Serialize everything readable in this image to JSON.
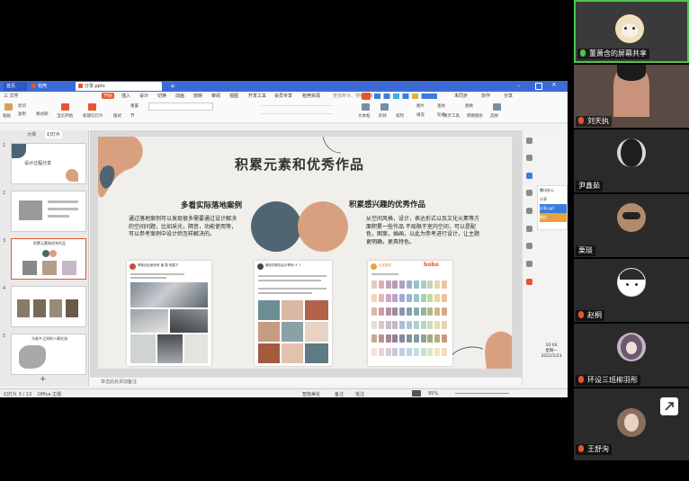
{
  "window": {
    "tabs": [
      {
        "label": "首页"
      },
      {
        "label": "稻壳"
      },
      {
        "label": "分享.pptx"
      }
    ],
    "new_tab": "+",
    "menu": [
      "三 文件",
      "开始",
      "插入",
      "设计",
      "切换",
      "动画",
      "放映",
      "审阅",
      "视图",
      "开发工具",
      "会员专享",
      "稻壳资源",
      "查找命令、搜索模板"
    ],
    "menu_active_index": 1,
    "menu_right": [
      "未同步",
      "协作",
      "分享"
    ],
    "ribbon": {
      "paste": "粘贴",
      "cut": "剪切",
      "copy": "复制",
      "format_painter": "格式刷",
      "from_start": "当页开始",
      "new_slide": "新建幻灯片",
      "layout": "版式",
      "section": "节",
      "reset": "重置",
      "font_placeholder": "",
      "text_box": "文本框",
      "shape": "形状",
      "arrange": "排列",
      "outline": "轮廓",
      "image": "图片",
      "fill": "填充",
      "find": "查找",
      "replace": "替换",
      "select": "选择",
      "presenter_tools": "演示工具",
      "convert_shape": "转换图形"
    },
    "thumb_tabs": {
      "outline": "大纲",
      "slides": "幻灯片"
    },
    "thumbnails": [
      {
        "num": "1",
        "title": "设计过程分享"
      },
      {
        "num": "2",
        "title": ""
      },
      {
        "num": "3",
        "title": "积累元素和优秀作品"
      },
      {
        "num": "4",
        "title": ""
      },
      {
        "num": "5",
        "title": "与老乡之间的人情交流"
      }
    ],
    "notes_placeholder": "单击此处添加备注",
    "status": {
      "slide_count": "幻灯片 3 / 13",
      "theme": "Office 主题",
      "smart_beautify": "智能美化",
      "notes_btn": "备注",
      "comment_btn": "批注",
      "zoom": "95%"
    },
    "right_panel": {
      "office": "腾讯办公",
      "share": "分享",
      "file": "分享.ppt",
      "wechat": "微信"
    }
  },
  "slide": {
    "title": "积累元素和优秀作品",
    "left_heading": "多看实际落地案例",
    "left_text": "通过落地案例可以发现很多需要通过设计解决的空间问题，比如采光，隔音，功能使用等，可以参考案例中设计师怎样解决的。",
    "right_heading": "积累感兴趣的优秀作品",
    "right_text": "从空间风格，设计，表达形式以及文化元素等方面积累一些作品 不局限于室内空间，可以是配色，图案，插画，以此为参考进行设计，让主题更明确，更具特色。",
    "card1_header": "青新创业股份有 最 整 恒建下",
    "card2_header": "微信学家协会分享网 十 1",
    "card3_header": "日本配色",
    "card3_badge": "bobo",
    "colors": {
      "dark_circle": "#4f6571",
      "peach_circle": "#d9a080",
      "accent_brown": "#b8724c",
      "blob_dark": "#4c6574"
    }
  },
  "participants": [
    {
      "name": "董萧含的屏幕共享",
      "mic": true
    },
    {
      "name": "刘天执",
      "mic": true
    },
    {
      "name": "尹鑫茹",
      "mic": false
    },
    {
      "name": "栗琰",
      "mic": false
    },
    {
      "name": "赵桐",
      "mic": true
    },
    {
      "name": "环设三班柳羽彤",
      "mic": true
    },
    {
      "name": "王舒洵",
      "mic": true
    }
  ],
  "taskbar_clock": {
    "time": "10:04",
    "day": "星期一",
    "date": "2022/5/23"
  }
}
